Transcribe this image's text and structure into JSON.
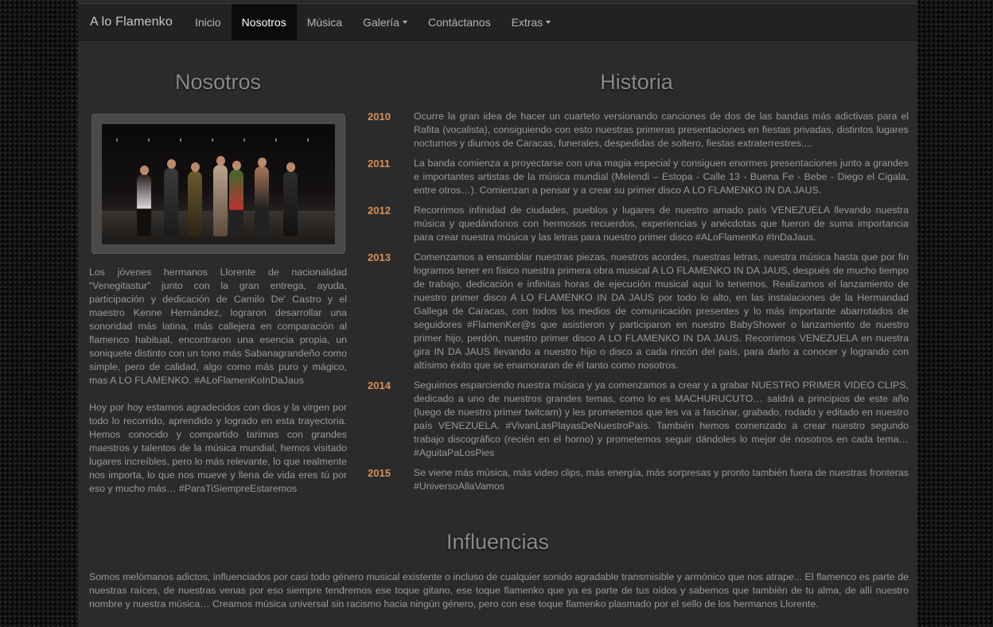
{
  "nav": {
    "brand": "A lo Flamenko",
    "items": [
      {
        "label": "Inicio",
        "active": false,
        "dropdown": false
      },
      {
        "label": "Nosotros",
        "active": true,
        "dropdown": false
      },
      {
        "label": "Música",
        "active": false,
        "dropdown": false
      },
      {
        "label": "Galería",
        "active": false,
        "dropdown": true
      },
      {
        "label": "Contáctanos",
        "active": false,
        "dropdown": false
      },
      {
        "label": "Extras",
        "active": false,
        "dropdown": true
      }
    ]
  },
  "nosotros": {
    "title": "Nosotros",
    "paragraphs": [
      "Los jóvenes hermanos Llorente de nacionalidad “Venegitastur” junto con la gran entrega, ayuda, participación y dedicación de Camilo De' Castro y el maestro Kenne Hernández, lograron desarrollar una sonoridad más latina, más callejera en comparación al flamenco habitual, encontraron una esencia propia, un soniquete distinto con un tono más Sabanagrandeño como simple, pero de calidad, algo como más puro y mágico, mas A LO FLAMENKO. #ALoFlamenKoInDaJaus",
      "Hoy por hoy estamos agradecidos con dios y la virgen por todo lo recorrido, aprendido y logrado en esta trayectoria. Hemos conocido y compartido tarimas con grandes maestros y talentos de la música mundial, hemos visitado lugares increíbles, pero lo más relevante, lo que realmente nos importa, lo que nos mueve y llena de vida eres tú por eso y mucho más… #ParaTiSiempreEstaremos"
    ]
  },
  "historia": {
    "title": "Historia",
    "entries": [
      {
        "year": "2010",
        "text": "Ocurre la gran idea de hacer un cuarteto versionando canciones de dos de las bandas más adictivas para el Rafita (vocalista), consiguiendo con esto nuestras primeras presentaciones en fiestas privadas, distintos lugares nocturnos y diurnos de Caracas, funerales, despedidas de soltero, fiestas extraterrestres...."
      },
      {
        "year": "2011",
        "text": "La banda comienza a proyectarse con una magia especial y consiguen enormes presentaciones junto a grandes e importantes artistas de la música mundial (Melendi – Estopa - Calle 13 - Buena Fe - Bebe - Diego el Cigala, entre otros…). Comienzan a pensar y a crear su primer disco A LO FLAMENKO IN DA JAUS."
      },
      {
        "year": "2012",
        "text": "Recorrimos infinidad de ciudades, pueblos y lugares de nuestro amado país VENEZUELA llevando nuestra música y quedándonos con hermosos recuerdos, experiencias y anécdotas que fueron de suma importancia para crear nuestra música y las letras para nuestro primer disco #ALoFlamenKo #InDaJaus."
      },
      {
        "year": "2013",
        "text": "Comenzamos a ensamblar nuestras piezas, nuestros acordes, nuestras letras, nuestra música hasta que por fin logramos tener en físico nuestra primera obra musical A LO FLAMENKO IN DA JAUS, después de mucho tiempo de trabajo, dedicación e infinitas horas de ejecución musical aquí lo tenemos. Realizamos el lanzamiento de nuestro primer disco A LO FLAMENKO IN DA JAUS por todo lo alto, en las instalaciones de la Hermandad Gallega de Caracas, con todos los medios de comunicación presentes y lo más importante abarrotados de seguidores #FlamenKer@s que asistieron y participaron en nuestro BabyShower o lanzamiento de nuestro primer hijo, perdón, nuestro primer disco A LO FLAMENKO IN DA JAUS. Recorrimos VENEZUELA en nuestra gira IN DA JAUS llevando a nuestro hijo o disco a cada rincón del país, para darlo a conocer y logrando con altísimo éxito que se enamoraran de él tanto como nosotros."
      },
      {
        "year": "2014",
        "text": "Seguimos esparciendo nuestra música y ya comenzamos a crear y a grabar NUESTRO PRIMER VIDEO CLIPS, dedicado a uno de nuestros grandes temas, como lo es MACHURUCUTO… saldrá a principios de este año (luego de nuestro primer twitcam) y les prometemos que les va a fascinar, grabado, rodado y editado en nuestro país VENEZUELA. #VivanLasPlayasDeNuestroPaís. También hemos comenzado a crear nuestro segundo trabajo discográfico (recién en el horno) y prometemos seguir dándoles lo mejor de nosotros en cada tema… #AguitaPaLosPies"
      },
      {
        "year": "2015",
        "text": "Se viene más música, más video clips, más energía, más sorpresas y pronto también fuera de nuestras fronteras #UniversoAllaVamos"
      }
    ]
  },
  "influencias": {
    "title": "Influencias",
    "text": "Somos melómanos adictos, influenciados por casi todo género musical existente o incluso de cualquier sonido agradable transmisible y armónico que nos atrape... El flamenco es parte de nuestras raíces, de nuestras venas por eso siempre tendremos ese toque gitano, ese toque flamenko que ya es parte de tus oídos y sabemos que también de tu alma, de allí nuestro nombre y nuestra música… Creamos música universal sin racismo hacia ningún género, pero con ese toque flamenko plasmado por el sello de los hermanos Llorente."
  },
  "colors": {
    "year": "#d7915a",
    "page_bg": "#2b2b2b",
    "navbar_bg": "#222222",
    "nav_active_bg": "#0b0b0b"
  }
}
